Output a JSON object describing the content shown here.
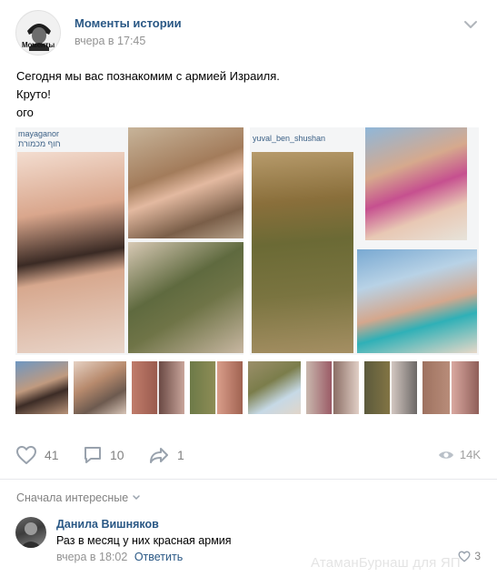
{
  "post": {
    "author": "Моменты истории",
    "avatar_logo_text": "Моменты",
    "time": "вчера в 17:45",
    "text_lines": [
      "Сегодня мы вас познакомим с армией Израиля.",
      "Круто!",
      "ого"
    ],
    "collage_tags": {
      "left_username": "mayaganor",
      "left_location": "חוף מכמורת",
      "right_username": "yuval_ben_shushan"
    }
  },
  "actions": {
    "likes": "41",
    "comments": "10",
    "shares": "1",
    "views": "14K"
  },
  "comments_section": {
    "sort_label": "Сначала интересные",
    "comment": {
      "author": "Данила Вишняков",
      "text": "Раз в месяц у них красная армия",
      "time": "вчера в 18:02",
      "reply_label": "Ответить",
      "likes": "3"
    }
  },
  "watermark": "АтаманБурнаш для ЯП",
  "icons": {
    "menu": "chevron-down-icon",
    "like": "heart-icon",
    "comment": "comment-bubble-icon",
    "share": "share-arrow-icon",
    "views": "eye-icon",
    "comment_like": "heart-icon"
  },
  "colors": {
    "link_blue": "#2a5885",
    "meta_gray": "#939393",
    "icon_gray": "#828282",
    "divider": "#e7e8ec"
  }
}
